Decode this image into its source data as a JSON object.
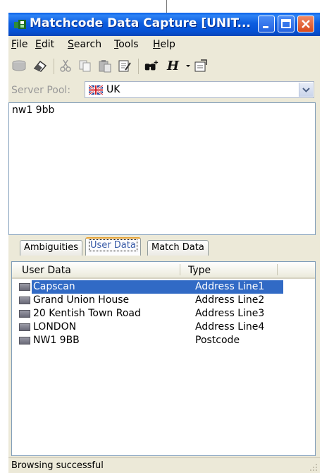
{
  "window": {
    "title": "Matchcode Data Capture [UNIT..."
  },
  "menu": [
    {
      "label": "File",
      "key": "F"
    },
    {
      "label": "Edit",
      "key": "E"
    },
    {
      "label": "Search",
      "key": "S"
    },
    {
      "label": "Tools",
      "key": "T"
    },
    {
      "label": "Help",
      "key": "H"
    }
  ],
  "toolbar": {
    "icons": [
      "database-icon",
      "eraser-icon",
      "cut-icon",
      "copy-icon",
      "paste-icon",
      "clear-icon",
      "binoculars-plus-icon",
      "h-format-icon",
      "dropdown-arrow-icon",
      "properties-icon"
    ]
  },
  "server": {
    "label": "Server Pool:",
    "value": "UK"
  },
  "input": {
    "text": "nw1 9bb"
  },
  "tabs": [
    {
      "label": "Ambiguities",
      "active": false
    },
    {
      "label": "User Data",
      "active": true
    },
    {
      "label": "Match Data",
      "active": false
    }
  ],
  "list": {
    "columns": [
      "User Data",
      "Type"
    ],
    "rows": [
      {
        "user_data": "Capscan",
        "type": "Address Line1",
        "selected": true
      },
      {
        "user_data": "Grand Union House",
        "type": "Address Line2",
        "selected": false
      },
      {
        "user_data": "20 Kentish Town Road",
        "type": "Address Line3",
        "selected": false
      },
      {
        "user_data": "LONDON",
        "type": "Address Line4",
        "selected": false
      },
      {
        "user_data": "NW1 9BB",
        "type": "Postcode",
        "selected": false
      }
    ]
  },
  "status": {
    "text": "Browsing successful"
  },
  "colors": {
    "titlebar": "#0a5ce0",
    "selection": "#316ac5",
    "window_bg": "#ece9d8",
    "tab_highlight": "#e6a233"
  }
}
